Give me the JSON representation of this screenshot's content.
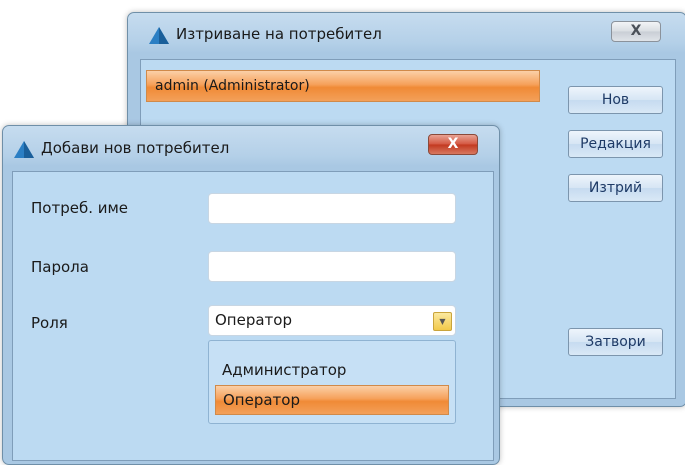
{
  "back_window": {
    "title": "Изтриване на потребител",
    "close_label": "X",
    "users_list": [
      "admin (Administrator)"
    ],
    "buttons": {
      "new": "Нов",
      "edit": "Редакция",
      "delete": "Изтрий",
      "close": "Затвори"
    }
  },
  "front_window": {
    "title": "Добави нов потребител",
    "close_label": "X",
    "fields": {
      "username_label": "Потреб. име",
      "username_value": "",
      "password_label": "Парола",
      "password_value": "",
      "role_label": "Роля",
      "role_value": "Оператор"
    },
    "role_options": [
      "Администратор",
      "Оператор"
    ],
    "role_selected_index": 1
  },
  "icons": {
    "app_logo": "triangle-logo-icon",
    "dropdown": "chevron-down-icon"
  },
  "colors": {
    "window_frame": "#b4d0e8",
    "client_area": "#bcdaf2",
    "selection_orange": "#f08a36",
    "close_red": "#c2381f"
  }
}
